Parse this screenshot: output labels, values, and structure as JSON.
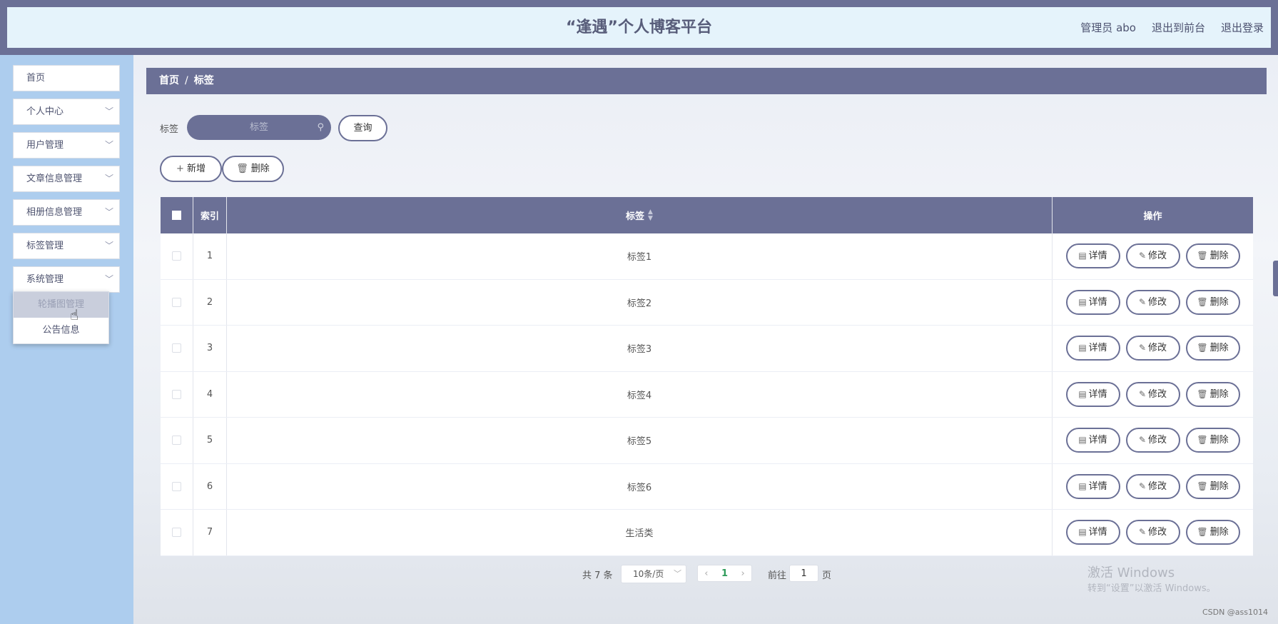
{
  "header": {
    "title": "“逢遇”个人博客平台",
    "user": "管理员 abo",
    "links": [
      "退出到前台",
      "退出登录"
    ]
  },
  "sidebar": {
    "items": [
      {
        "label": "首页",
        "has_chevron": false
      },
      {
        "label": "个人中心",
        "has_chevron": true
      },
      {
        "label": "用户管理",
        "has_chevron": true
      },
      {
        "label": "文章信息管理",
        "has_chevron": true
      },
      {
        "label": "相册信息管理",
        "has_chevron": true
      },
      {
        "label": "标签管理",
        "has_chevron": true
      },
      {
        "label": "系统管理",
        "has_chevron": true
      }
    ],
    "submenu": [
      "轮播图管理",
      "公告信息"
    ]
  },
  "breadcrumb": {
    "home": "首页",
    "separator": "/",
    "current": "标签"
  },
  "search": {
    "label": "标签",
    "placeholder": "标签",
    "button": "查询"
  },
  "actions": {
    "add": "新增",
    "delete": "删除"
  },
  "table": {
    "headers": {
      "index": "索引",
      "tag": "标签",
      "ops": "操作"
    },
    "rows": [
      {
        "index": "1",
        "tag": "标签1"
      },
      {
        "index": "2",
        "tag": "标签2"
      },
      {
        "index": "3",
        "tag": "标签3"
      },
      {
        "index": "4",
        "tag": "标签4"
      },
      {
        "index": "5",
        "tag": "标签5"
      },
      {
        "index": "6",
        "tag": "标签6"
      },
      {
        "index": "7",
        "tag": "生活类"
      }
    ],
    "row_ops": {
      "detail": "详情",
      "edit": "修改",
      "delete": "删除"
    }
  },
  "pagination": {
    "total": "共 7 条",
    "page_size": "10条/页",
    "current_page": "1",
    "goto_label": "前往",
    "goto_value": "1",
    "page_suffix": "页"
  },
  "watermark": {
    "line1": "激活 Windows",
    "line2": "转到“设置”以激活 Windows。"
  },
  "credit": "CSDN @ass1014",
  "colors": {
    "primary": "#6b7096",
    "sidebar_bg": "#adcdee",
    "header_bg": "#e5f3fb",
    "page_active": "#2e9b5a"
  }
}
